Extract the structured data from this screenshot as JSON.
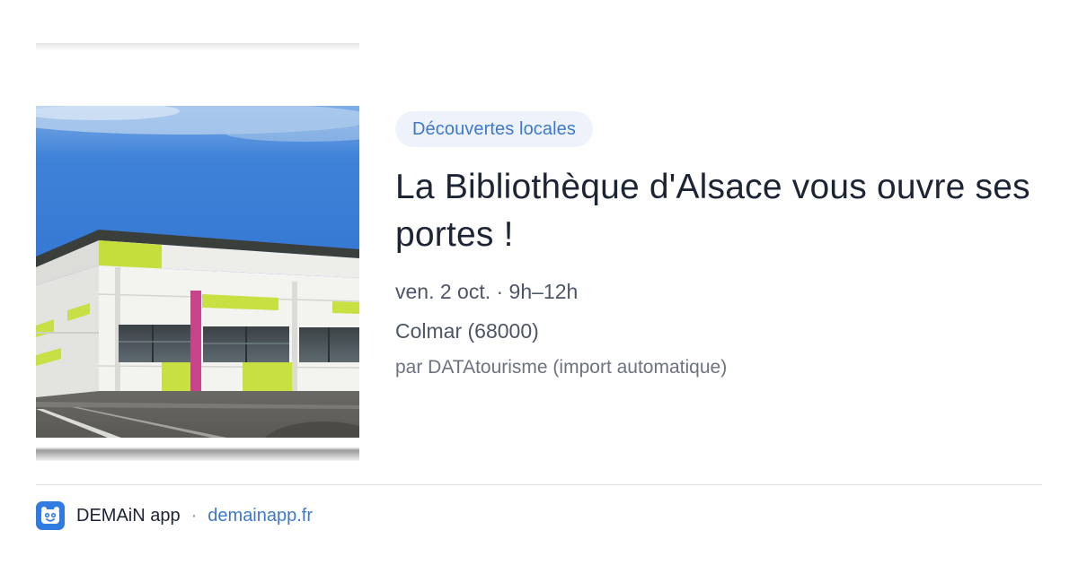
{
  "image": {
    "alt_icon": "building-photo",
    "colors": {
      "sky": "#3d7fd6",
      "wall": "#f1f1ee",
      "lime": "#c8e042",
      "magenta": "#c8448a",
      "asphalt": "#5b5a56"
    }
  },
  "category": {
    "label": "Découvertes locales",
    "color": "#3f78c9",
    "background": "#eef3fb"
  },
  "event": {
    "title": "La Bibliothèque d'Alsace vous ouvre ses portes !",
    "datetime": "ven. 2 oct. · 9h–12h",
    "location": "Colmar (68000)",
    "source": "par DATAtourisme (import automatique)"
  },
  "footer": {
    "app_icon": "demain-app-icon",
    "app_name": "DEMAiN app",
    "separator": "·",
    "domain": "demainapp.fr",
    "link_color": "#3f78c9"
  }
}
